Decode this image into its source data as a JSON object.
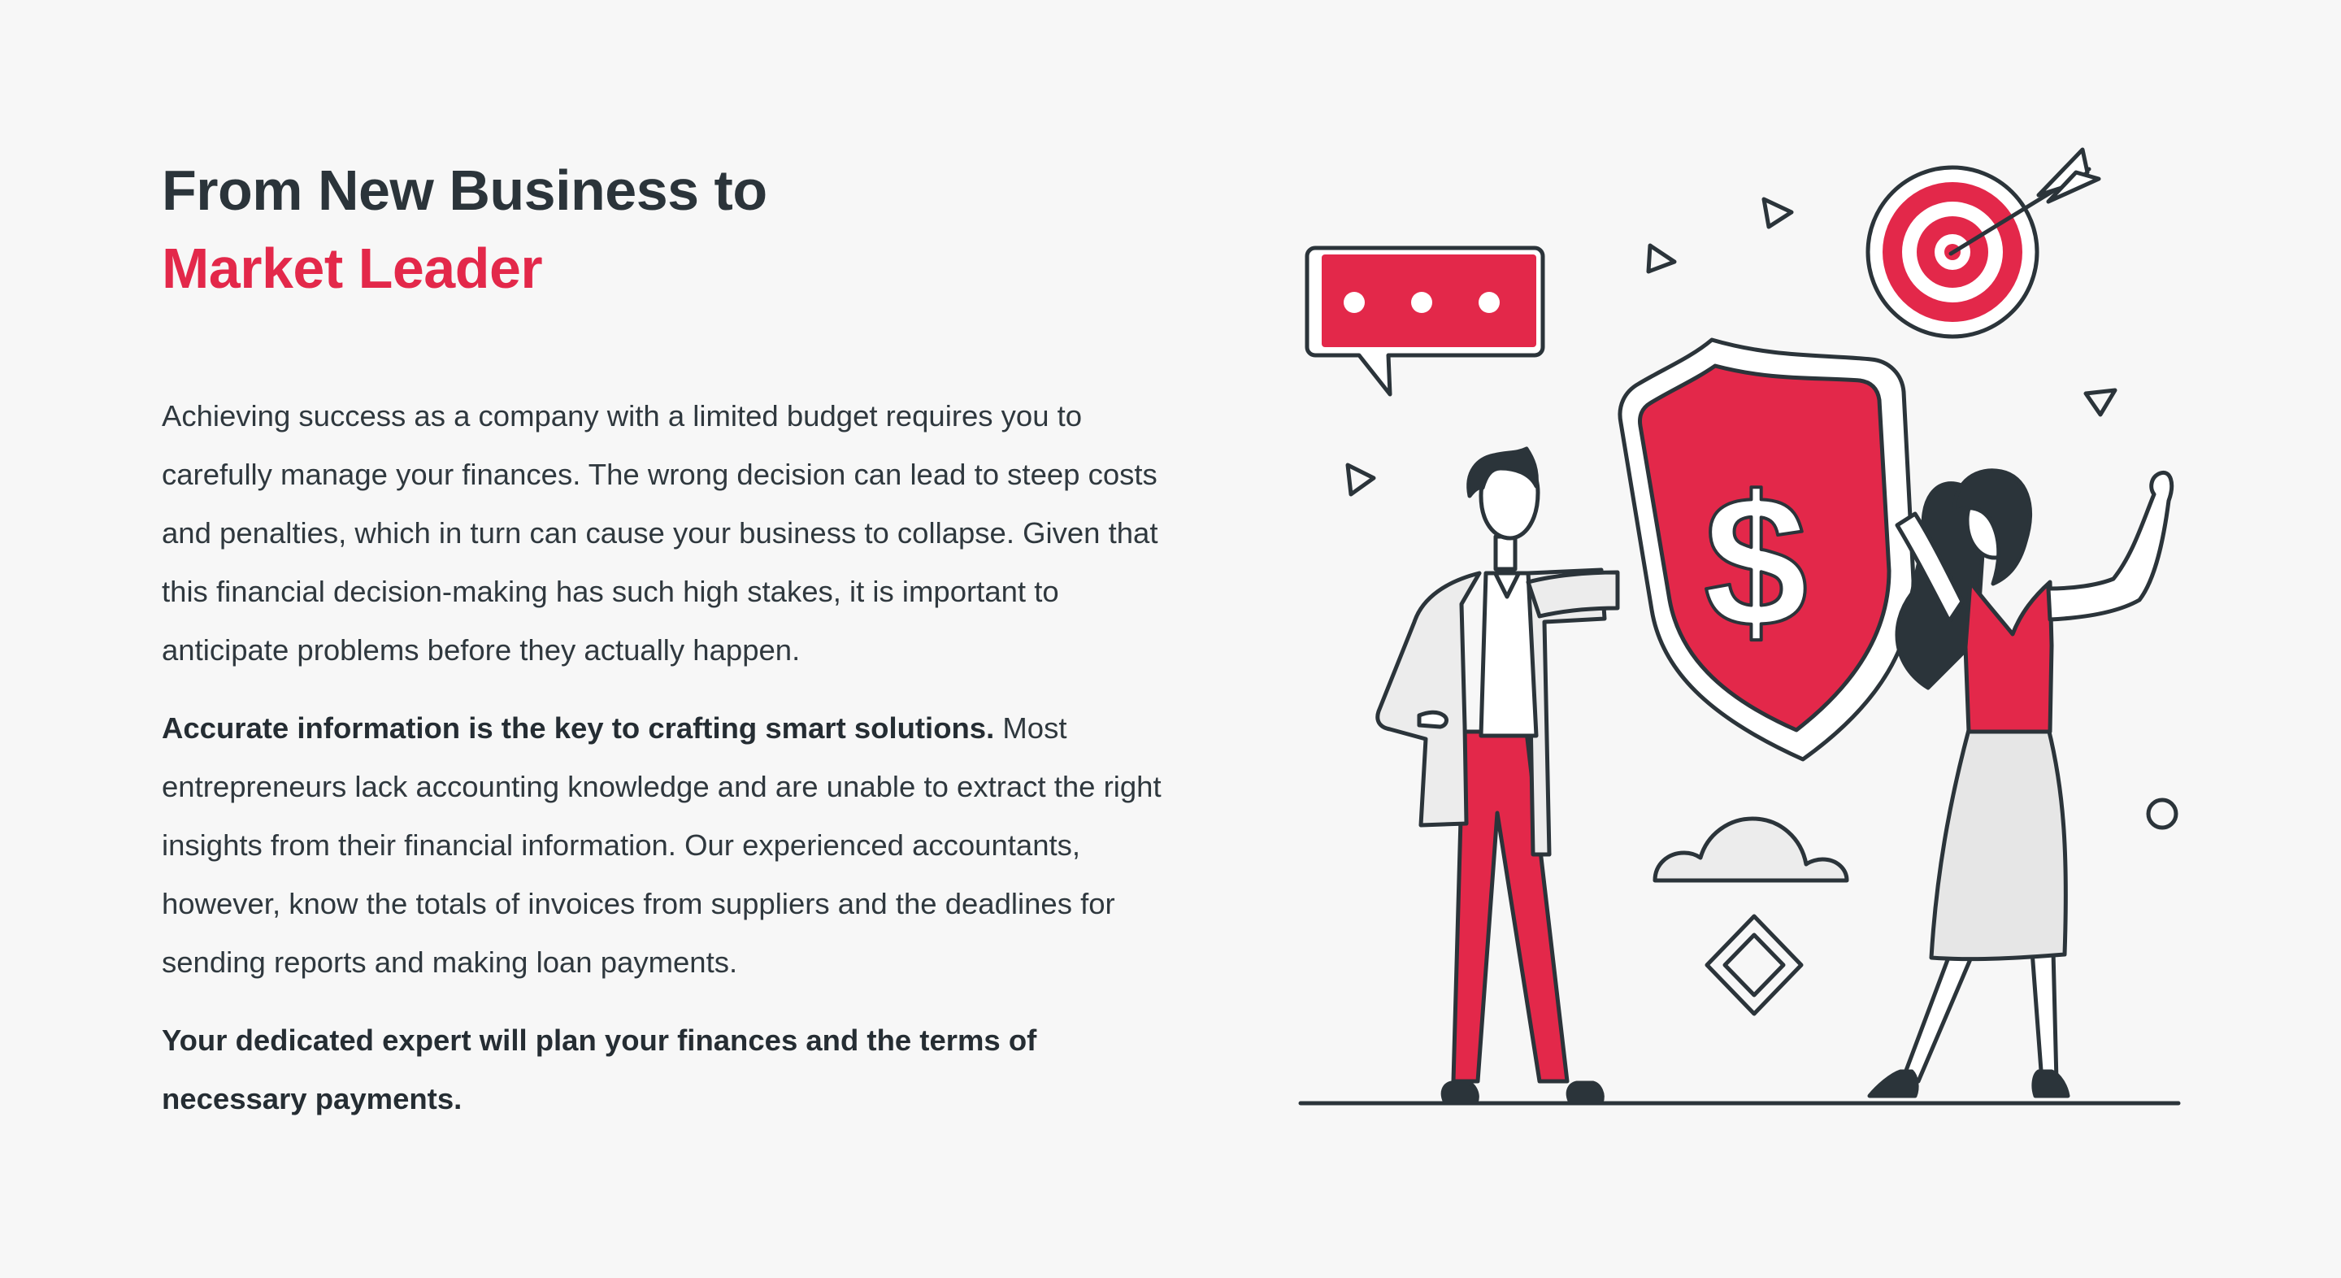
{
  "heading": {
    "line1": "From New Business to",
    "line2": "Market Leader"
  },
  "paragraphs": {
    "p1": "Achieving success as a company with a limited budget requires you to carefully manage your finances. The wrong decision can lead to steep costs and penalties, which in turn can cause your business to collapse. Given that this financial decision-making has such high stakes, it is important to anticipate problems before they actually happen.",
    "p2_bold": "Accurate information is the key to crafting smart solutions.",
    "p2_rest": " Most entrepreneurs lack accounting knowledge and are unable to extract the right insights from their financial information. Our experienced accountants, however, know the totals of invoices from suppliers and the deadlines for sending reports and making loan payments.",
    "p3_bold": "Your dedicated expert will plan your finances and the terms of necessary payments."
  },
  "illustration": {
    "shield_symbol": "$",
    "icons": [
      "speech-bubble-icon",
      "target-icon",
      "arrow-icon",
      "shield-dollar-icon",
      "cloud-icon",
      "diamond-icon",
      "triangle-icon",
      "circle-icon"
    ]
  },
  "colors": {
    "accent": "#e3284a",
    "text": "#2b343a",
    "background": "#f7f7f7",
    "outline": "#2b343a",
    "light_gray": "#e6e6e6"
  }
}
